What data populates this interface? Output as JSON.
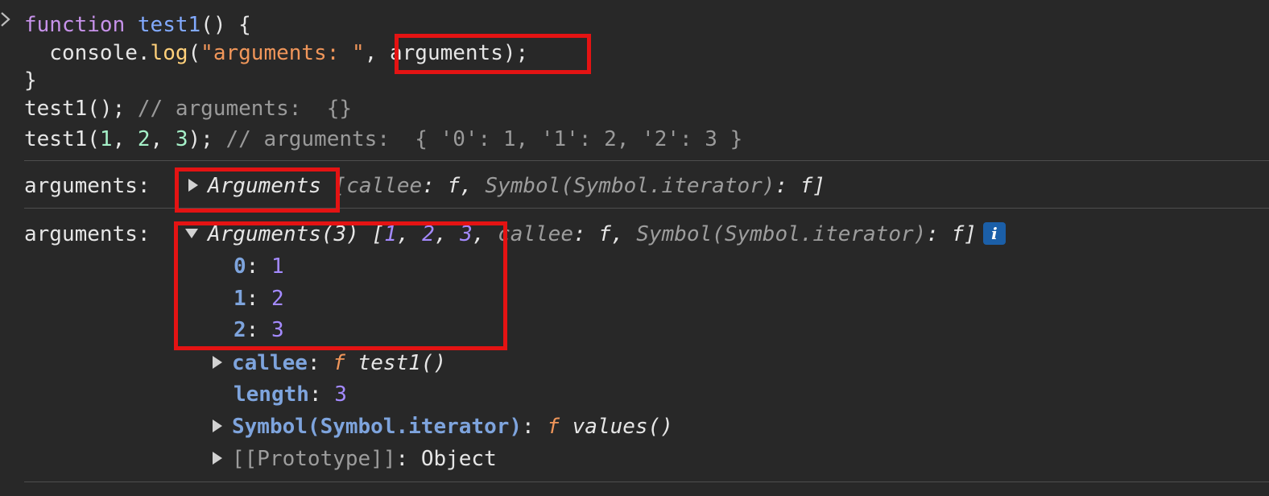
{
  "code": {
    "line1_kw": "function",
    "line1_name": "test1",
    "line1_rest": "() {",
    "line2_obj": "  console.",
    "line2_method": "log",
    "line2_paren": "(",
    "line2_str": "\"arguments: \"",
    "line2_comma": ", ",
    "line2_arg": "arguments);",
    "line3": "}",
    "line4_call": "test1(); ",
    "line4_comment": "// arguments:  {}",
    "line5_call_a": "test1(",
    "line5_n1": "1",
    "line5_sep1": ", ",
    "line5_n2": "2",
    "line5_sep2": ", ",
    "line5_n3": "3",
    "line5_end": "); ",
    "line5_comment": "// arguments:  { '0': 1, '1': 2, '2': 3 }"
  },
  "log1": {
    "label": "arguments: ",
    "type": "Arguments",
    "preview_open": " [",
    "callee_key": "callee",
    "colon1": ": ",
    "f1": "f",
    "sep": ", ",
    "symbol_key": "Symbol(Symbol.iterator)",
    "colon2": ": ",
    "f2": "f",
    "preview_close": "]"
  },
  "log2": {
    "label": "arguments: ",
    "type": "Arguments(3)",
    "preview_open": " [",
    "v1": "1",
    "v2": "2",
    "v3": "3",
    "sep": ", ",
    "callee_key": "callee",
    "colon": ": ",
    "f": "f",
    "symbol_key": "Symbol(Symbol.iterator)",
    "preview_close": "]",
    "info": "i",
    "entries": [
      {
        "key": "0",
        "value": "1"
      },
      {
        "key": "1",
        "value": "2"
      },
      {
        "key": "2",
        "value": "3"
      }
    ],
    "callee_prop": "callee",
    "callee_f": "f",
    "callee_val": "test1()",
    "length_prop": "length",
    "length_val": "3",
    "iter_prop": "Symbol(Symbol.iterator)",
    "iter_f": "f",
    "iter_val": "values()",
    "proto_prop": "[[Prototype]]",
    "proto_val": "Object"
  },
  "colors": {
    "background": "#282828",
    "highlight_box": "#e41313",
    "keyword": "#c792ea",
    "function_name": "#82aaff",
    "string": "#f0965a",
    "number_code": "#a5f0c8",
    "number_value": "#a48aff",
    "property_key": "#7ea4dd",
    "info_badge": "#1b5fa8"
  },
  "icons": {
    "prompt": "chevron-right-icon",
    "collapsed": "triangle-right-icon",
    "expanded": "triangle-down-icon",
    "info": "info-icon"
  }
}
